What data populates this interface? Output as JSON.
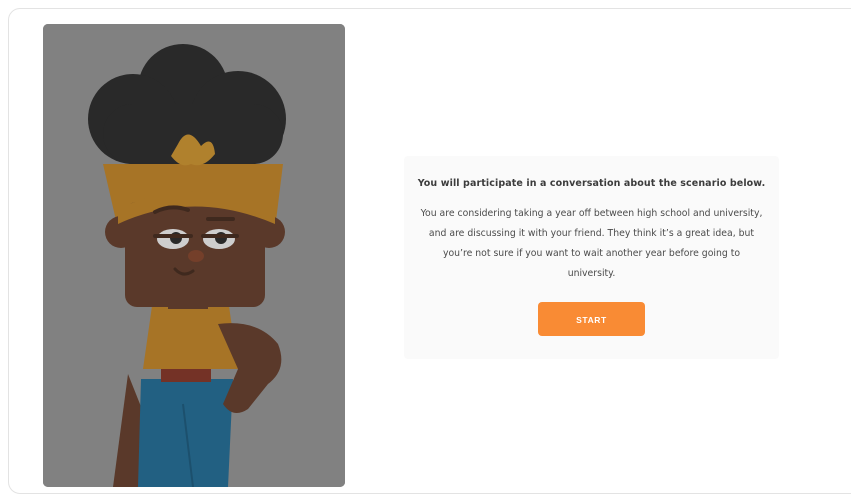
{
  "character": {
    "description_icon": "character-illustration"
  },
  "scenario": {
    "title": "You will participate in a conversation about the scenario below.",
    "lines": [
      "You are considering taking a year off between high school and university,",
      "and are discussing it with your friend. They think it’s a great idea, but",
      "you’re not sure if you want to wait another year before going to",
      "university."
    ],
    "start_label": "START"
  },
  "colors": {
    "accent": "#f98b34",
    "panel_bg": "#8a8a8a",
    "hair": "#1f1f1f",
    "skin": "#6b3a22",
    "headband": "#c9861d",
    "shirt": "#c9861d",
    "pants": "#1c6e9c"
  }
}
